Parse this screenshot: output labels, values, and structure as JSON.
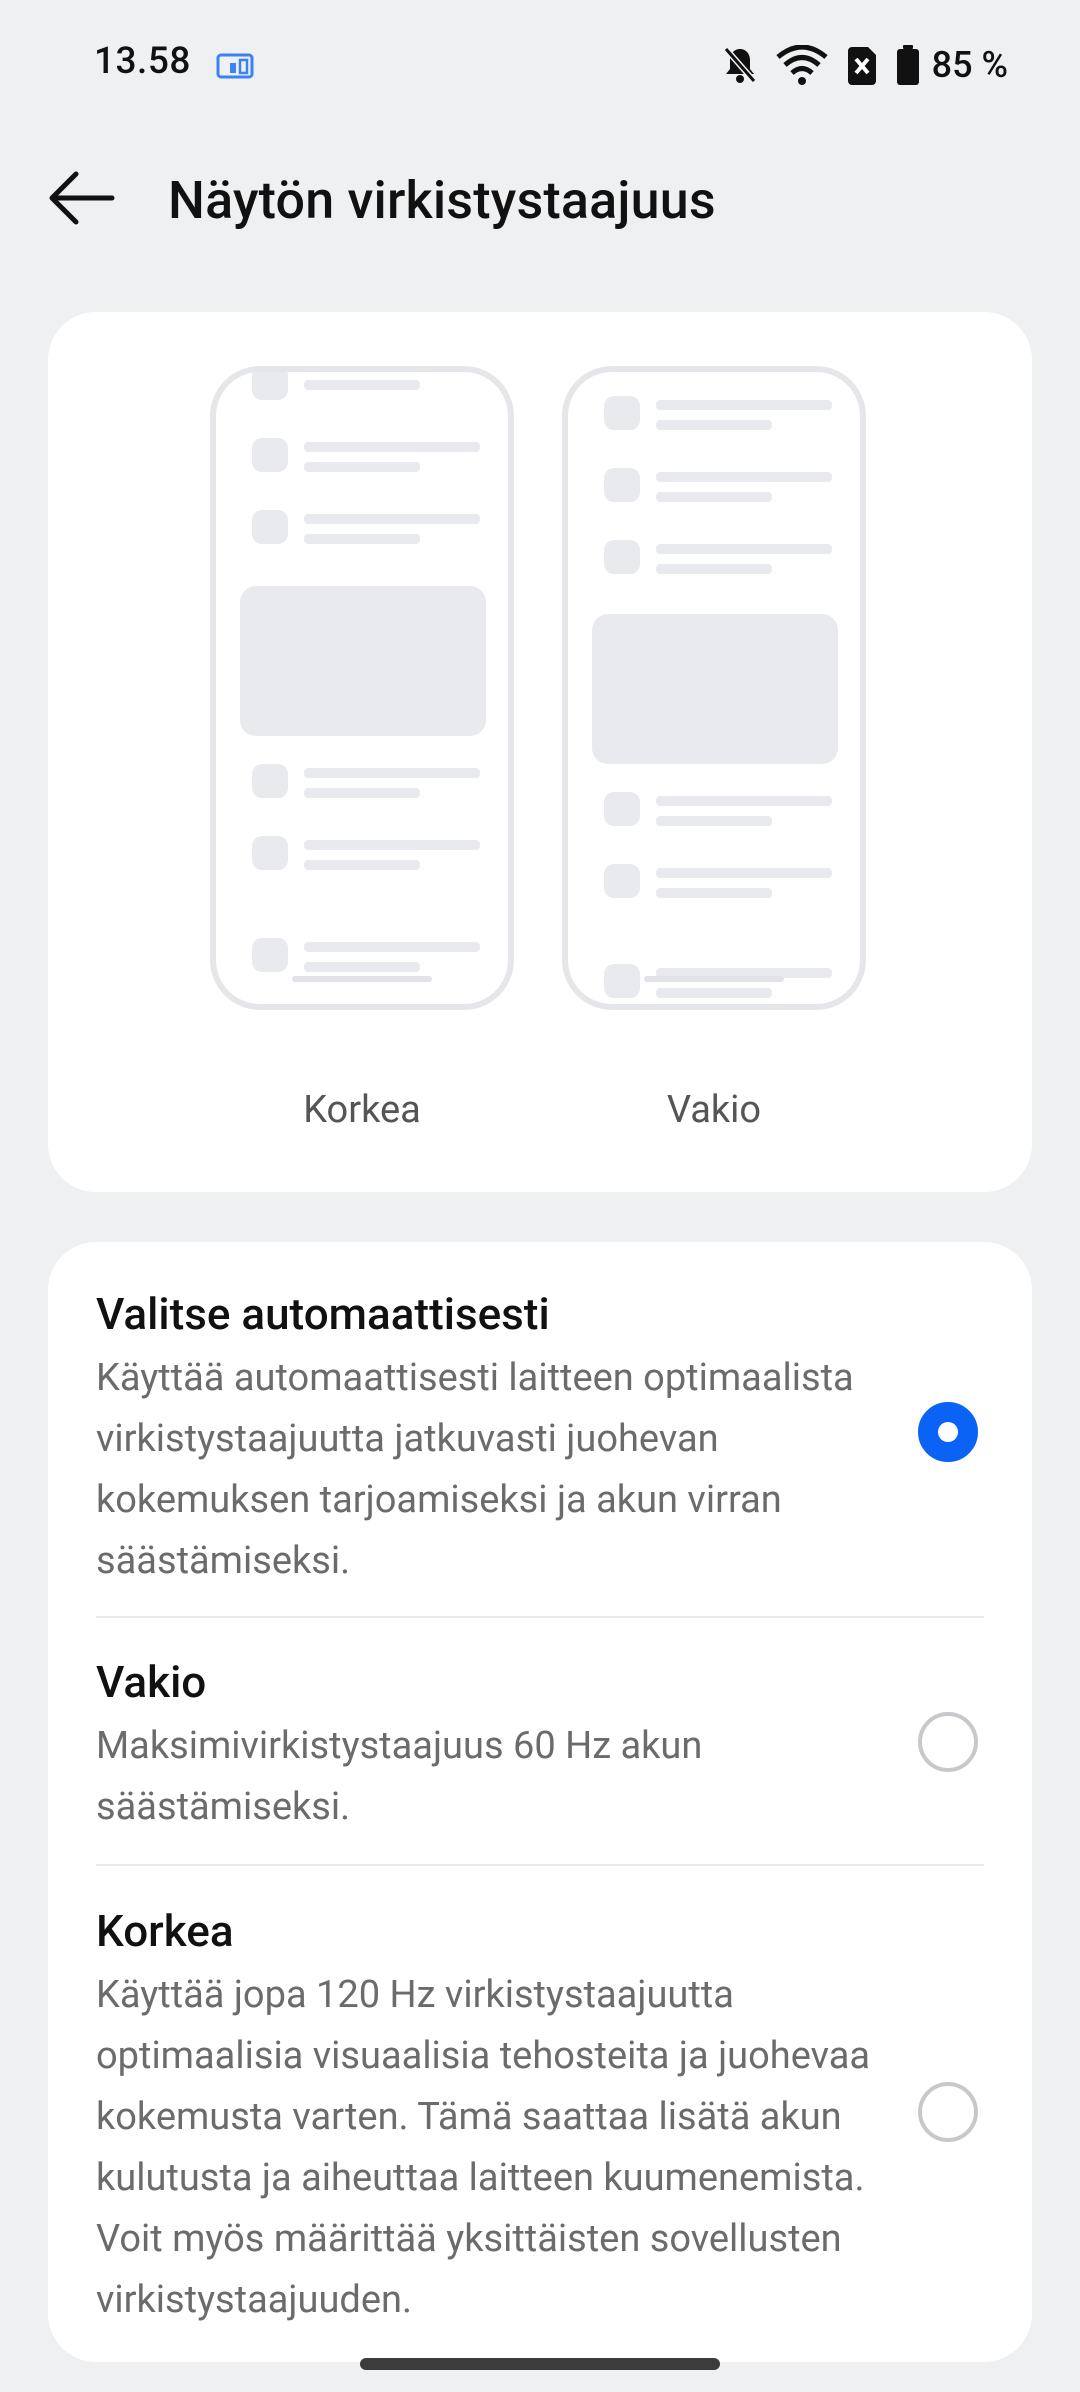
{
  "status": {
    "time": "13.58",
    "battery": "85 %"
  },
  "header": {
    "title": "Näytön virkistystaajuus"
  },
  "preview": {
    "left_label": "Korkea",
    "right_label": "Vakio"
  },
  "options": [
    {
      "title": "Valitse automaattisesti",
      "desc": "Käyttää automaattisesti laitteen optimaalista virkistystaajuutta jatkuvasti juohevan kokemuksen tarjoamiseksi ja akun virran säästämiseksi.",
      "selected": true
    },
    {
      "title": "Vakio",
      "desc": "Maksimivirkistystaajuus 60 Hz akun säästämiseksi.",
      "selected": false
    },
    {
      "title": "Korkea",
      "desc": "Käyttää jopa 120 Hz virkistystaajuutta optimaalisia visuaalisia tehosteita ja juohevaa kokemusta varten. Tämä saattaa lisätä akun kulutusta ja aiheuttaa laitteen kuumenemista. Voit myös määrittää yksittäisten sovellusten virkistystaajuuden.",
      "selected": false
    }
  ],
  "colors": {
    "accent": "#0a63f4",
    "background": "#eff0f2",
    "card": "#ffffff"
  }
}
